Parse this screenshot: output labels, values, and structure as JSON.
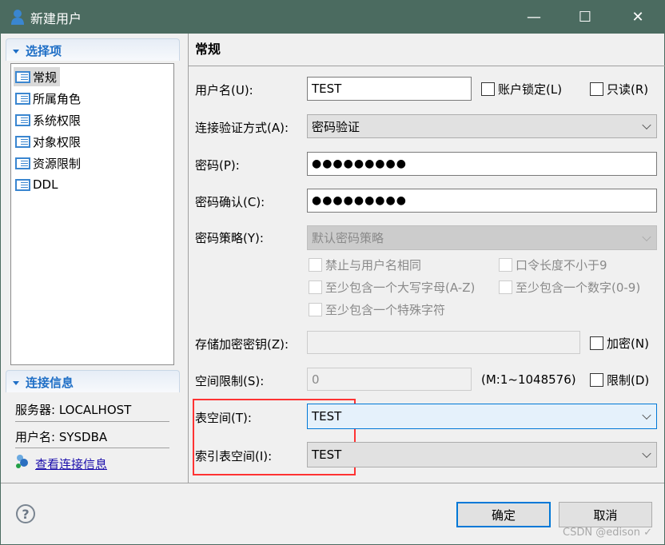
{
  "window": {
    "title": "新建用户",
    "minimize": "—",
    "maximize": "☐",
    "close": "✕"
  },
  "sidebar": {
    "options_header": "选择项",
    "items": [
      {
        "label": "常规"
      },
      {
        "label": "所属角色"
      },
      {
        "label": "系统权限"
      },
      {
        "label": "对象权限"
      },
      {
        "label": "资源限制"
      },
      {
        "label": "DDL"
      }
    ],
    "conn_header": "连接信息",
    "server": "服务器: LOCALHOST",
    "user": "用户名: SYSDBA",
    "view_link": "查看连接信息"
  },
  "main": {
    "heading": "常规",
    "username_label": "用户名(U):",
    "username_value": "TEST",
    "lock_label": "账户锁定(L)",
    "readonly_label": "只读(R)",
    "auth_label": "连接验证方式(A):",
    "auth_value": "密码验证",
    "password_label": "密码(P):",
    "password_value": "●●●●●●●●●",
    "confirm_label": "密码确认(C):",
    "confirm_value": "●●●●●●●●●",
    "policy_label": "密码策略(Y):",
    "policy_value": "默认密码策略",
    "policy_options": [
      "禁止与用户名相同",
      "口令长度不小于9",
      "至少包含一个大写字母(A-Z)",
      "至少包含一个数字(0-9)",
      "至少包含一个特殊字符"
    ],
    "key_label": "存储加密密钥(Z):",
    "key_value": "",
    "encrypt_label": "加密(N)",
    "space_label": "空间限制(S):",
    "space_value": "0",
    "space_range": "(M:1~1048576)",
    "limit_label": "限制(D)",
    "tablespace_label": "表空间(T):",
    "tablespace_value": "TEST",
    "index_tablespace_label": "索引表空间(I):",
    "index_tablespace_value": "TEST"
  },
  "footer": {
    "help": "?",
    "ok": "确定",
    "cancel": "取消",
    "watermark": "CSDN @edison ✓"
  },
  "colors": {
    "titlebar": "#4b6b60",
    "accent": "#0078d7",
    "highlight": "#ff3333"
  }
}
